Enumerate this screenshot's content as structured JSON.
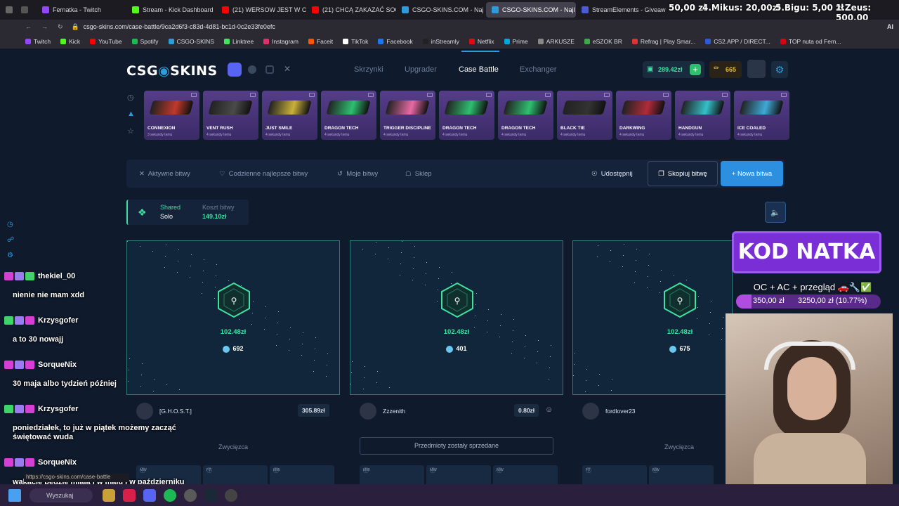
{
  "browser": {
    "tabs": [
      {
        "label": "Fernatka - Twitch",
        "color": "#9146ff"
      },
      {
        "label": "Stream - Kick Dashboard",
        "color": "#53fc18"
      },
      {
        "label": "(21) WERSOW JEST W CI",
        "color": "#ff0000"
      },
      {
        "label": "(21) CHCĄ ZAKAZAĆ SOC",
        "color": "#ff0000"
      },
      {
        "label": "CSGO-SKINS.COM - Naj",
        "color": "#2d9cdb"
      },
      {
        "label": "CSGO-SKINS.COM - Najl",
        "color": "#2d9cdb"
      },
      {
        "label": "StreamElements - Giveaw",
        "color": "#4b5bd6"
      }
    ],
    "url": "csgo-skins.com/case-battle/9ca2d6f3-c83d-4d81-bc1d-0c2e33fe0efc",
    "bookmarks": [
      "Twitch",
      "Kick",
      "YouTube",
      "Spotify",
      "CSGO-SKINS",
      "Linktree",
      "Instagram",
      "Faceit",
      "TikTok",
      "Facebook",
      "inStreamly",
      "Netflix",
      "Prime",
      "ARKUSZE",
      "eSZOK BR",
      "Refrag | Play Smar...",
      "CS2.APP / DIRECT...",
      "TOP nuta od Fern..."
    ],
    "status_url": "https://csgo-skins.com/case-battle",
    "ai_label": "AI"
  },
  "donations": [
    {
      "text": "50,00 zł"
    },
    {
      "text": "4.Mikus: 20,00zł"
    },
    {
      "text": "5.Bigu: 5,00 zł"
    },
    {
      "text": "1.Zeus: 500,00"
    }
  ],
  "site": {
    "logo": "CSG",
    "logo_tail": "SKINS",
    "nav": [
      {
        "label": "Skrzynki",
        "active": false
      },
      {
        "label": "Upgrader",
        "active": false
      },
      {
        "label": "Case Battle",
        "active": true
      },
      {
        "label": "Exchanger",
        "active": false
      }
    ],
    "balance": "289.42zł",
    "coins": "665",
    "drops": [
      {
        "name": "CONNEXION",
        "time": "3 sekundy temu",
        "color": "#c0392b"
      },
      {
        "name": "VENT RUSH",
        "time": "4 sekundy temu",
        "color": "#4a4a4a"
      },
      {
        "name": "JUST SMILE",
        "time": "4 sekundy temu",
        "color": "#c9b13a"
      },
      {
        "name": "DRAGON TECH",
        "time": "4 sekundy temu",
        "color": "#2fbf71"
      },
      {
        "name": "TRIGGER DISCIPLINE",
        "time": "4 sekundy temu",
        "color": "#e86aa4"
      },
      {
        "name": "DRAGON TECH",
        "time": "4 sekundy temu",
        "color": "#2fbf71"
      },
      {
        "name": "DRAGON TECH",
        "time": "4 sekundy temu",
        "color": "#2fbf71"
      },
      {
        "name": "BLACK TIE",
        "time": "4 sekundy temu",
        "color": "#333333"
      },
      {
        "name": "DARKWING",
        "time": "4 sekundy temu",
        "color": "#b02b3a"
      },
      {
        "name": "HANDGUN",
        "time": "4 sekundy temu",
        "color": "#35c0c8"
      },
      {
        "name": "ICE COALED",
        "time": "4 sekundy temu",
        "color": "#3fa9d6"
      }
    ],
    "battle_menu": {
      "active": "Aktywne bitwy",
      "daily": "Codzienne najlepsze bitwy",
      "mine": "Moje bitwy",
      "shop": "Sklep",
      "share": "Udostępnij",
      "copy": "Skopiuj bitwę",
      "new": "+ Nowa bitwa"
    },
    "battle_info": {
      "mode": "Shared",
      "type": "Solo",
      "cost_label": "Koszt bitwy",
      "cost": "149.10zł"
    },
    "players": [
      {
        "name": "[G.H.O.S.T.]",
        "value": "305.89zł",
        "price": "102.48zł",
        "coins": "692",
        "footer": "Zwycięzca",
        "sold": false,
        "minis": [
          "MW",
          "FT",
          "MW"
        ]
      },
      {
        "name": "Zzzenith",
        "value": "0.80zł",
        "price": "102.48zł",
        "coins": "401",
        "footer": "Przedmioty zostały sprzedane",
        "sold": true,
        "minis": [
          "MW",
          "MW",
          "MW"
        ]
      },
      {
        "name": "fordlover23",
        "value": "",
        "price": "102.48zł",
        "coins": "675",
        "footer": "Zwycięzca",
        "sold": false,
        "minis": [
          "FT",
          "MW"
        ]
      }
    ]
  },
  "overlay": {
    "kod": "KOD NATKA",
    "promo": "OC + AC + przegląd 🚗🔧✅",
    "goal_current": "350,00 zł",
    "goal_target": "3250,00 zł (10.77%)",
    "goal_progress": 0.1077
  },
  "chat": [
    {
      "user": "thekiel_00",
      "msg": "nienie nie mam xdd"
    },
    {
      "user": "Krzysgofer",
      "msg": "a to 30 nowajj"
    },
    {
      "user": "SorqueNix",
      "msg": "30 maja albo tydzień później"
    },
    {
      "user": "Krzysgofer",
      "msg": "poniedziałek, to już w piątek możemy zacząć świętować wuda"
    },
    {
      "user": "SorqueNix",
      "msg": "wakacje będzie miała i w maju i w październiku NOTED"
    }
  ],
  "taskbar": {
    "search": "Wyszukaj"
  },
  "colors": {
    "accent": "#2d9cdb",
    "green": "#3fe0a1",
    "purple": "#7a2fd6"
  }
}
